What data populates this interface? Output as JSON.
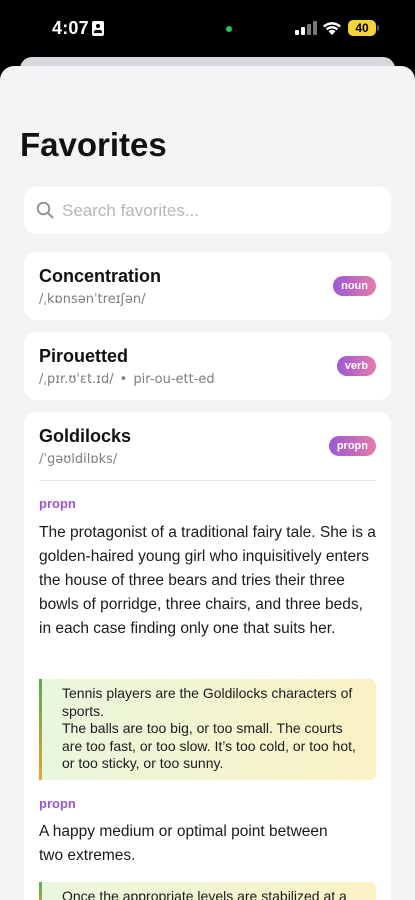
{
  "status_bar": {
    "time": "4:07",
    "battery": "40",
    "colors": {
      "dot": "#22c55e",
      "battery_fill": "#f2d33b"
    }
  },
  "page": {
    "title": "Favorites"
  },
  "search": {
    "placeholder": "Search favorites...",
    "value": ""
  },
  "colors": {
    "badge_noun": [
      "#9b59d6",
      "#e87aa8"
    ],
    "badge_verb": [
      "#9b59d6",
      "#e87aa8"
    ],
    "sense_label": "#9a55d6",
    "example_bg": [
      "#e9f7dd",
      "#fbf2c4"
    ],
    "example_border": [
      "#4caf50",
      "#f0a030"
    ]
  },
  "favorites": [
    {
      "word": "Concentration",
      "pronunciation": "/ˌkɒnsənˈtreɪʃən/",
      "syllables": "",
      "pos": "noun"
    },
    {
      "word": "Pirouetted",
      "pronunciation": "/ˌpɪr.ʊˈɛt.ɪd/",
      "syllables": "pir-ou-ett-ed",
      "pos": "verb"
    },
    {
      "word": "Goldilocks",
      "pronunciation": "/ˈɡəʊldilɒks/",
      "pos": "propn",
      "senses": [
        {
          "pos": "propn",
          "definition": "The protagonist of a traditional fairy tale. She is a golden-haired young girl who inquisitively enters the house of three bears and tries their three bowls of porridge, three chairs, and three beds, in each case finding only one that suits her.",
          "example_lines": [
            "Tennis players are the Goldilocks characters of sports.",
            "The balls are too big, or too small. The courts are too fast, or too slow. It’s too cold, or too hot, or too sticky, or too sunny."
          ]
        },
        {
          "pos": "propn",
          "definition": "A happy medium or optimal point between two extremes.",
          "example_lines": [
            "Once the appropriate levels are stabilized at a"
          ]
        }
      ]
    }
  ]
}
